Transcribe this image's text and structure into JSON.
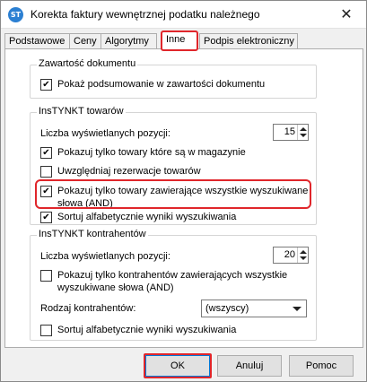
{
  "window": {
    "title": "Korekta faktury wewnętrznej podatku należnego",
    "icon_text": "ST",
    "close_glyph": "✕"
  },
  "tabs": [
    {
      "label": "Podstawowe",
      "active": false
    },
    {
      "label": "Ceny",
      "active": false
    },
    {
      "label": "Algorytmy",
      "active": false
    },
    {
      "label": "Inne",
      "active": true
    },
    {
      "label": "Podpis elektroniczny",
      "active": false
    }
  ],
  "document_group": {
    "title": "Zawartość dokumentu",
    "show_summary": {
      "label": "Pokaż podsumowanie w zawartości dokumentu",
      "checked": true
    }
  },
  "goods_group": {
    "title": "InsTYNKT towarów",
    "count_label": "Liczba wyświetlanych pozycji:",
    "count_value": "15",
    "only_in_stock": {
      "label": "Pokazuj tylko towary które są w magazynie",
      "checked": true
    },
    "include_reservations": {
      "label": "Uwzględniaj rezerwacje towarów",
      "checked": false
    },
    "all_words": {
      "label": "Pokazuj tylko towary zawierające wszystkie wyszukiwane słowa (AND)",
      "checked": true
    },
    "sort_alpha": {
      "label": "Sortuj alfabetycznie wyniki wyszukiwania",
      "checked": true
    }
  },
  "contractors_group": {
    "title": "InsTYNKT kontrahentów",
    "count_label": "Liczba wyświetlanych pozycji:",
    "count_value": "20",
    "all_words": {
      "label": "Pokazuj tylko kontrahentów zawierających wszystkie wyszukiwane słowa (AND)",
      "checked": false
    },
    "kind_label": "Rodzaj kontrahentów:",
    "kind_value": "(wszyscy)",
    "sort_alpha": {
      "label": "Sortuj alfabetycznie wyniki wyszukiwania",
      "checked": false
    }
  },
  "buttons": {
    "ok": "OK",
    "cancel": "Anuluj",
    "help": "Pomoc"
  },
  "colors": {
    "highlight": "#e0262b",
    "app_icon": "#2b7fd2",
    "default_button_border": "#0078d7"
  }
}
